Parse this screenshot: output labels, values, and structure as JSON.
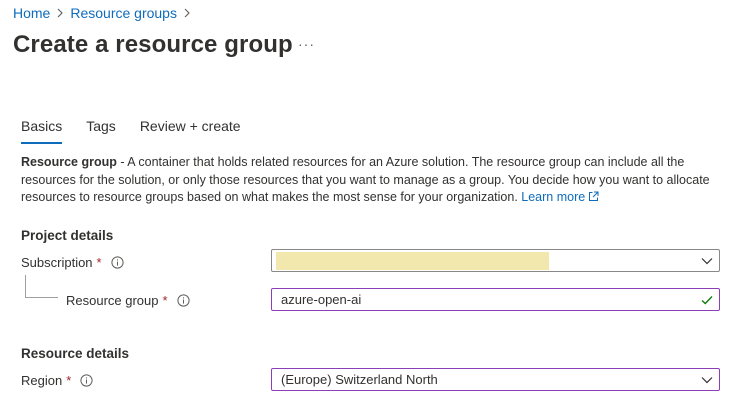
{
  "breadcrumb": {
    "items": [
      {
        "label": "Home"
      },
      {
        "label": "Resource groups"
      }
    ]
  },
  "page": {
    "title": "Create a resource group",
    "more": "···"
  },
  "tabs": [
    {
      "label": "Basics",
      "active": true
    },
    {
      "label": "Tags",
      "active": false
    },
    {
      "label": "Review + create",
      "active": false
    }
  ],
  "description": {
    "bold": "Resource group",
    "text": " - A container that holds related resources for an Azure solution. The resource group can include all the resources for the solution, or only those resources that you want to manage as a group. You decide how you want to allocate resources to resource groups based on what makes the most sense for your organization. ",
    "learn_more": "Learn more"
  },
  "project_details": {
    "title": "Project details",
    "subscription": {
      "label": "Subscription",
      "required": "*",
      "value": ""
    },
    "resource_group": {
      "label": "Resource group",
      "required": "*",
      "value": "azure-open-ai"
    }
  },
  "resource_details": {
    "title": "Resource details",
    "region": {
      "label": "Region",
      "required": "*",
      "value": "(Europe) Switzerland North"
    }
  },
  "colors": {
    "link": "#0f6cbd",
    "required": "#a4262c",
    "focus_border": "#8a3fb8",
    "valid_check": "#107c10",
    "redaction": "#f2e7ad"
  },
  "icons": [
    "chevron-right-icon",
    "ellipsis-icon",
    "external-link-icon",
    "info-icon",
    "chevron-down-icon",
    "checkmark-icon"
  ]
}
